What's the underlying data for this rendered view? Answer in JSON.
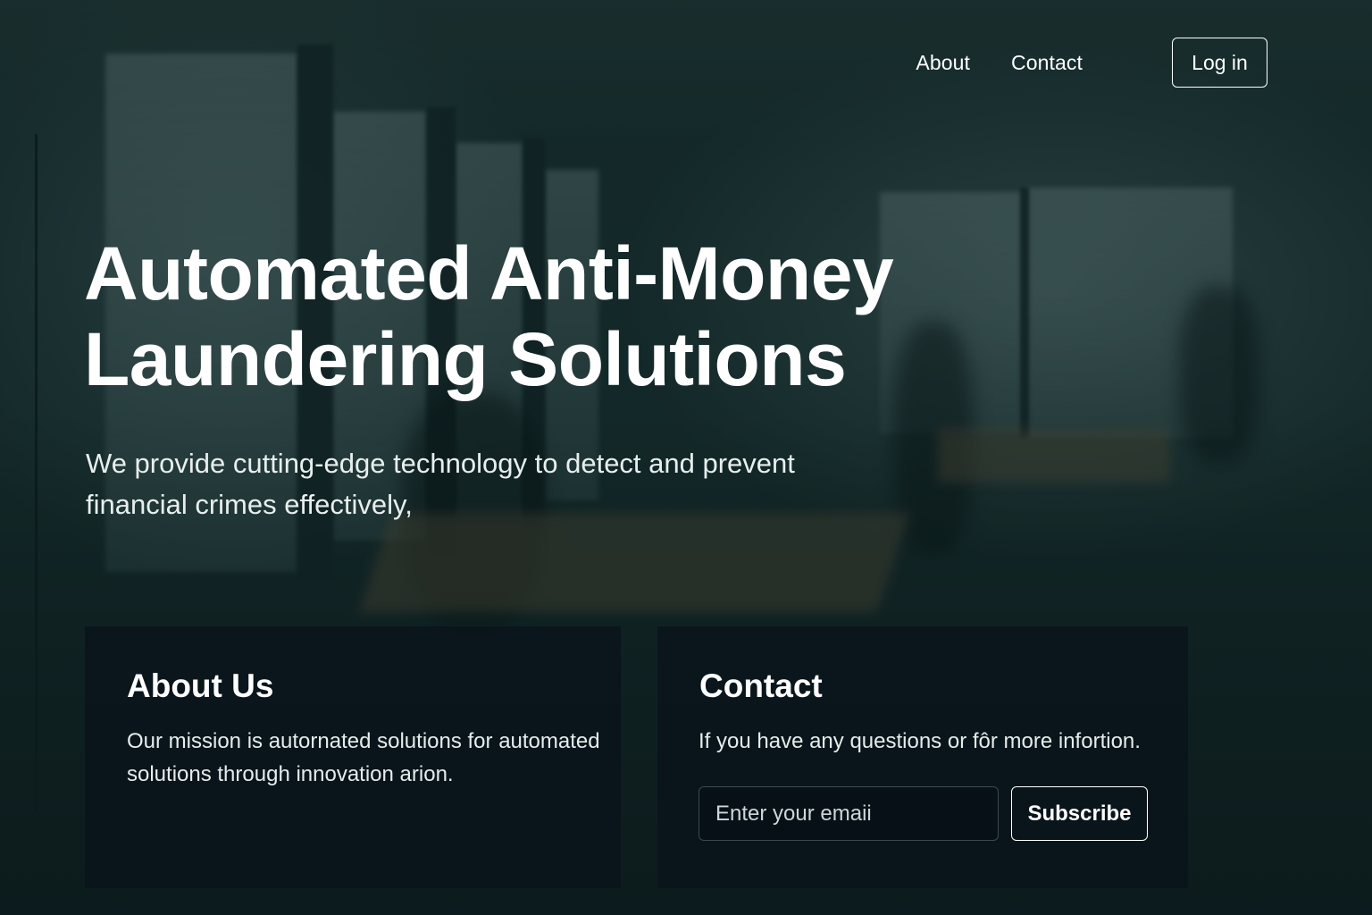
{
  "nav": {
    "links": [
      "About",
      "Contact"
    ],
    "login_label": "Log in"
  },
  "hero": {
    "title": "Automated Anti-Money Laundering Solutions",
    "subtitle": "We provide cutting-edge technology to detect and prevent financial crimes effectively,"
  },
  "about": {
    "title": "About Us",
    "text": "Our mission is autornated solutions for automated solutions through innovation arion."
  },
  "contact": {
    "title": "Contact",
    "text": "If you have any questions or fôr more infortion.",
    "email_placeholder": "Enter your emaii",
    "subscribe_label": "Subscribe"
  },
  "colors": {
    "background": "#1a3031",
    "card": "#0a141b",
    "text": "#ffffff"
  },
  "background_image": "blurred-office-interior"
}
